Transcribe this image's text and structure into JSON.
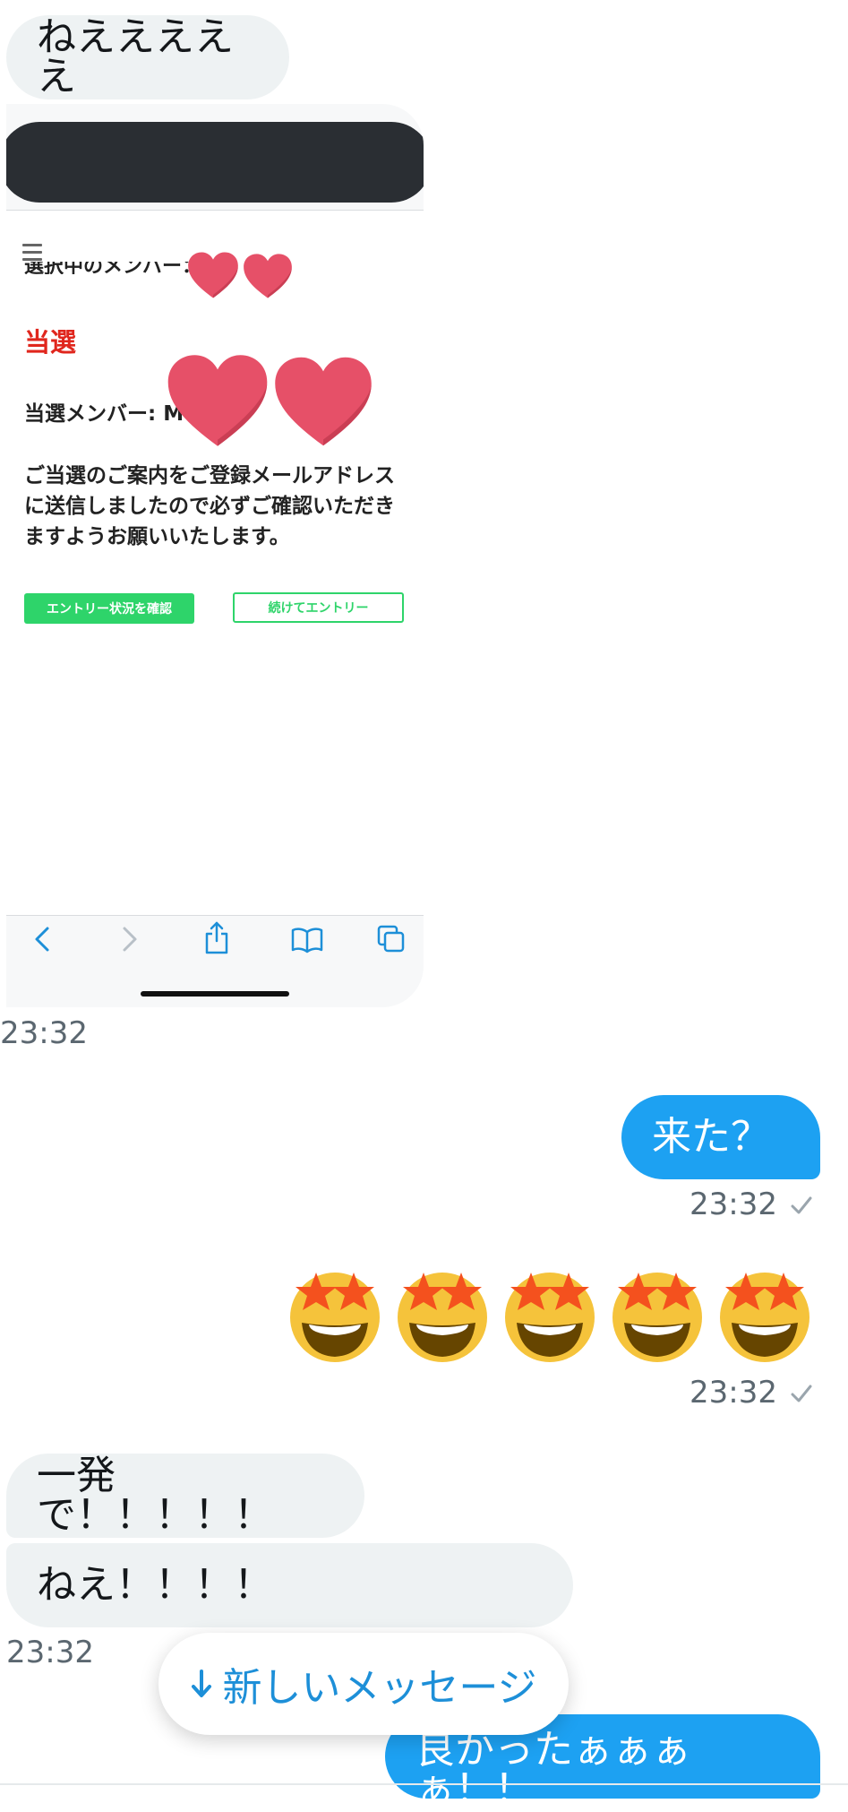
{
  "messages": {
    "msg1": "ねえええええ",
    "shot_time": "23:32",
    "msg2": "来た？",
    "msg2_time": "23:32",
    "emoji_time": "23:32",
    "msg3": "一発で！！！！！",
    "msg4": "ねえ！！！！",
    "msg34_time": "23:32",
    "msg5": "良かったぁぁぁぁ！！"
  },
  "screenshot": {
    "cut_text": "選択中のメンバー：",
    "win_title": "当選",
    "member": "当選メンバー: M",
    "notice": "ご当選のご案内をご登録メールアドレスに送信しましたので必ずご確認いただきますようお願いいたします。",
    "btn_status": "エントリー状況を確認",
    "btn_continue": "続けてエントリー"
  },
  "new_message_button": "新しいメッセージ",
  "icons": {
    "heart": "heart-icon",
    "star_struck": "star-struck-emoji",
    "check": "check-icon",
    "arrow_down": "arrow-down-icon",
    "back": "chevron-left-icon",
    "forward": "chevron-right-icon",
    "share": "share-icon",
    "bookmarks": "book-icon",
    "tabs": "tabs-icon",
    "menu": "hamburger-icon"
  },
  "colors": {
    "outgoing": "#1da1f2",
    "incoming": "#eef2f3",
    "winner_red": "#e0261d",
    "entry_green": "#2ed46a",
    "heart": "#e65068"
  }
}
